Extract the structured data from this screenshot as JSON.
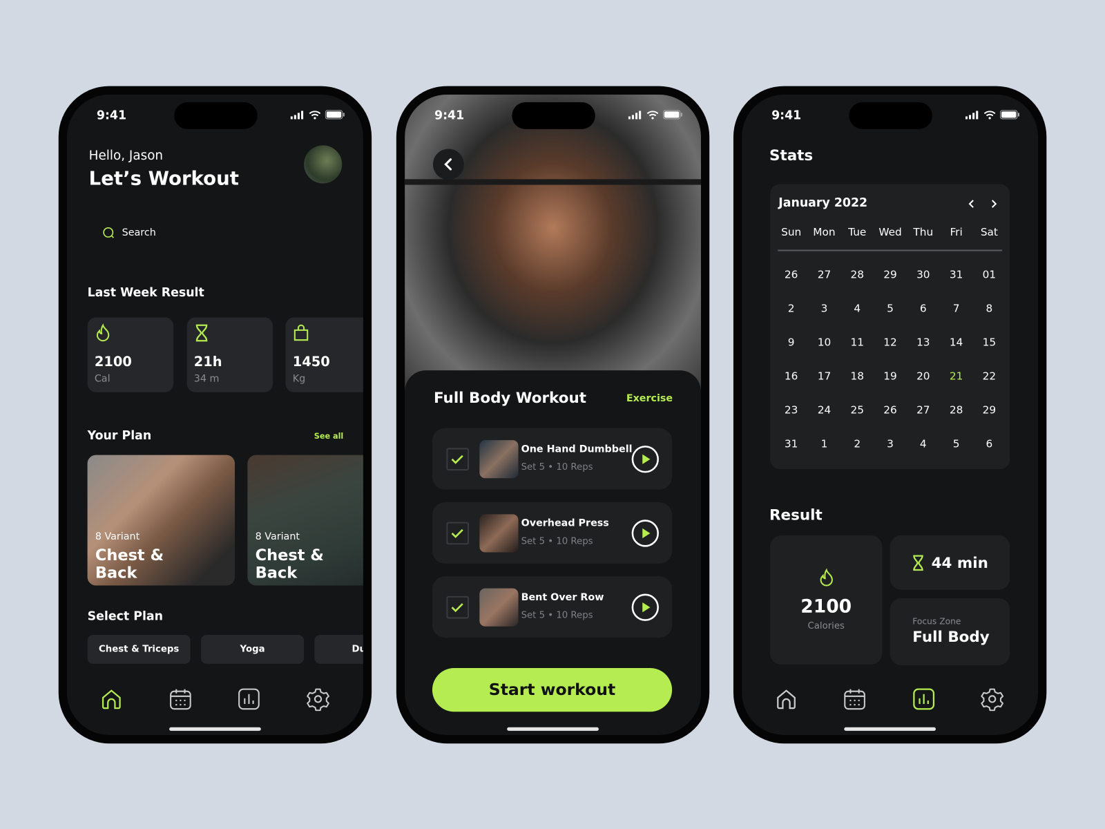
{
  "colors": {
    "accent": "#b5ec52",
    "background": "#d2d9e2",
    "screen": "#141517",
    "card": "#26272a"
  },
  "status_time": "9:41",
  "home": {
    "greeting": "Hello, Jason",
    "title": "Let’s Workout",
    "search_placeholder": "Search",
    "last_week_title": "Last Week Result",
    "stats": [
      {
        "icon": "flame-icon",
        "value": "2100",
        "unit": "Cal"
      },
      {
        "icon": "hourglass-icon",
        "value": "21h",
        "unit": "34 m"
      },
      {
        "icon": "weight-icon",
        "value": "1450",
        "unit": "Kg"
      }
    ],
    "your_plan_title": "Your Plan",
    "see_all": "See all",
    "plans": [
      {
        "variant": "8 Variant",
        "title": "Chest & Back"
      },
      {
        "variant": "8 Variant",
        "title": "Chest & Back"
      }
    ],
    "select_plan_title": "Select Plan",
    "chips": [
      "Chest & Triceps",
      "Yoga",
      "Du"
    ],
    "nav": [
      "home-icon",
      "calendar-icon",
      "stats-icon",
      "settings-icon"
    ],
    "nav_active": "home"
  },
  "workout": {
    "title": "Full Body Workout",
    "exercise_link": "Exercise",
    "exercises": [
      {
        "name": "One Hand Dumbbell",
        "detail": "Set 5 • 10 Reps",
        "checked": true
      },
      {
        "name": "Overhead Press",
        "detail": "Set 5 • 10 Reps",
        "checked": true
      },
      {
        "name": "Bent Over Row",
        "detail": "Set 5 • 10 Reps",
        "checked": true
      }
    ],
    "start_button": "Start workout"
  },
  "stats": {
    "title": "Stats",
    "month": "January 2022",
    "weekdays": [
      "Sun",
      "Mon",
      "Tue",
      "Wed",
      "Thu",
      "Fri",
      "Sat"
    ],
    "weeks": [
      [
        "26",
        "27",
        "28",
        "29",
        "30",
        "31",
        "01"
      ],
      [
        "2",
        "3",
        "4",
        "5",
        "6",
        "7",
        "8"
      ],
      [
        "9",
        "10",
        "11",
        "12",
        "13",
        "14",
        "15"
      ],
      [
        "16",
        "17",
        "18",
        "19",
        "20",
        "21",
        "22"
      ],
      [
        "23",
        "24",
        "25",
        "26",
        "27",
        "28",
        "29"
      ],
      [
        "31",
        "1",
        "2",
        "3",
        "4",
        "5",
        "6"
      ]
    ],
    "selected_day": "21",
    "result_title": "Result",
    "calories_value": "2100",
    "calories_label": "Calories",
    "duration": "44 min",
    "focus_label": "Focus Zone",
    "focus_value": "Full Body",
    "nav_active": "stats"
  }
}
